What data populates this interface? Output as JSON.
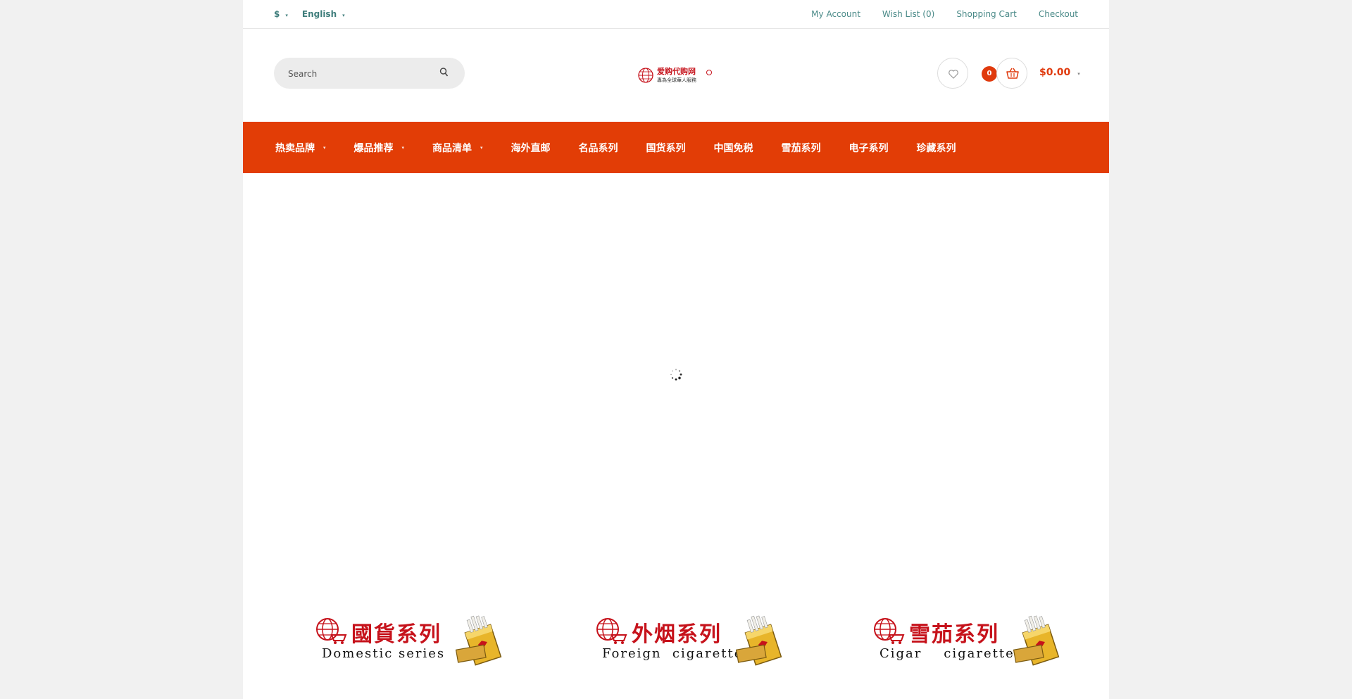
{
  "topbar": {
    "currency": "$",
    "language": "English",
    "links": [
      "My Account",
      "Wish List (0)",
      "Shopping Cart",
      "Checkout"
    ]
  },
  "header": {
    "search_placeholder": "Search",
    "logo_title": "爱购代购网",
    "logo_subtitle": "專為全球華人服務",
    "cart_count": "0",
    "cart_total": "$0.00"
  },
  "nav": {
    "items": [
      "热卖品牌",
      "爆品推荐",
      "商品清单",
      "海外直邮",
      "名品系列",
      "国货系列",
      "中国免税",
      "雪茄系列",
      "电子系列",
      "珍藏系列"
    ],
    "has_dropdown": [
      true,
      true,
      true,
      false,
      false,
      false,
      false,
      false,
      false,
      false
    ]
  },
  "banners": [
    {
      "cn": "國貨系列",
      "en": "Domestic series"
    },
    {
      "cn": "外烟系列",
      "en": "Foreign  cigarettes"
    },
    {
      "cn": "雪茄系列",
      "en": "Cigar    cigarettes"
    }
  ],
  "colors": {
    "accent": "#e23d06",
    "link": "#4a8a88",
    "banner_red": "#c6121b"
  }
}
